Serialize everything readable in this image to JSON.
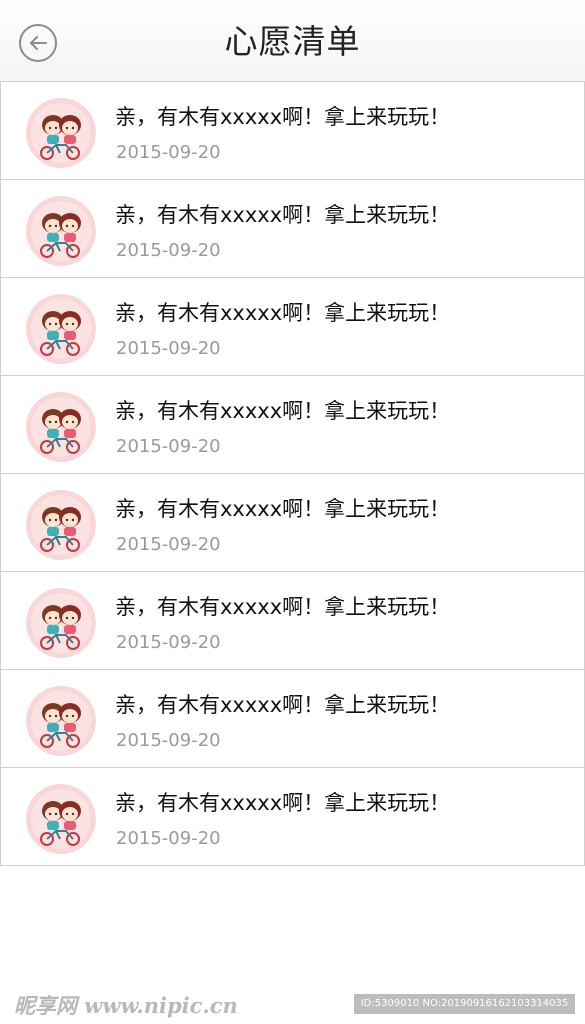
{
  "header": {
    "title": "心愿清单",
    "back_icon": "arrow-left-icon"
  },
  "wishes": [
    {
      "title": "亲，有木有xxxxx啊！拿上来玩玩！",
      "date": "2015-09-20"
    },
    {
      "title": "亲，有木有xxxxx啊！拿上来玩玩！",
      "date": "2015-09-20"
    },
    {
      "title": "亲，有木有xxxxx啊！拿上来玩玩！",
      "date": "2015-09-20"
    },
    {
      "title": "亲，有木有xxxxx啊！拿上来玩玩！",
      "date": "2015-09-20"
    },
    {
      "title": "亲，有木有xxxxx啊！拿上来玩玩！",
      "date": "2015-09-20"
    },
    {
      "title": "亲，有木有xxxxx啊！拿上来玩玩！",
      "date": "2015-09-20"
    },
    {
      "title": "亲，有木有xxxxx啊！拿上来玩玩！",
      "date": "2015-09-20"
    },
    {
      "title": "亲，有木有xxxxx啊！拿上来玩玩！",
      "date": "2015-09-20"
    }
  ],
  "watermark": {
    "site": "昵享网 www.nipic.cn",
    "id_text": "ID:5309010 NO:20190916162103314035"
  },
  "colors": {
    "title_text": "#222222",
    "date_text": "#9a9a9a",
    "divider": "#cfcfcf",
    "avatar_bg": "#f9d6d8"
  }
}
